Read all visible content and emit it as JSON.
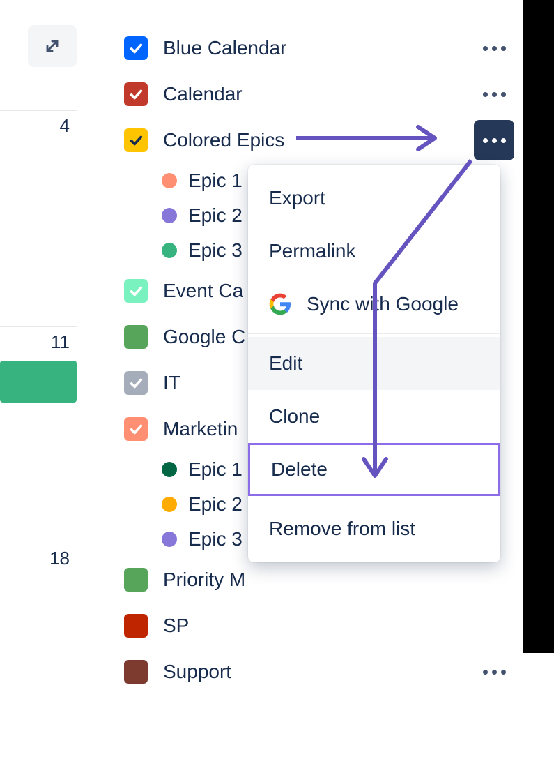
{
  "toolbar": {
    "expand_icon": "expand"
  },
  "days": [
    "4",
    "11",
    "18"
  ],
  "calendars": [
    {
      "label": "Blue Calendar",
      "color": "#0065ff",
      "check": "white",
      "has_menu": true
    },
    {
      "label": "Calendar",
      "color": "#c0392b",
      "check": "white",
      "has_menu": true
    },
    {
      "label": "Colored Epics",
      "color": "#ffc400",
      "check": "black",
      "has_menu": true,
      "active": true,
      "epics": [
        {
          "label": "Epic 1",
          "color": "#ff8f73"
        },
        {
          "label": "Epic 2",
          "color": "#8777d9"
        },
        {
          "label": "Epic 3",
          "color": "#36b37e"
        }
      ]
    },
    {
      "label": "Event Ca",
      "color": "#79f2c0",
      "check": "white",
      "has_menu": false
    },
    {
      "label": "Google C",
      "color": "#57a55a",
      "check": "none",
      "square": true,
      "has_menu": false
    },
    {
      "label": "IT",
      "color": "#a5adba",
      "check": "white",
      "has_menu": false
    },
    {
      "label": "Marketin",
      "color": "#ff8f73",
      "check": "white",
      "has_menu": false,
      "epics": [
        {
          "label": "Epic 1",
          "color": "#006644"
        },
        {
          "label": "Epic 2",
          "color": "#ffab00"
        },
        {
          "label": "Epic 3",
          "color": "#8777d9"
        }
      ]
    },
    {
      "label": "Priority M",
      "color": "#57a55a",
      "check": "none",
      "square": true,
      "has_menu": false
    },
    {
      "label": "SP",
      "color": "#bf2600",
      "check": "none",
      "square": true,
      "has_menu": false
    },
    {
      "label": "Support",
      "color": "#7c3b2e",
      "check": "none",
      "square": true,
      "has_menu": true
    }
  ],
  "menu": {
    "export": "Export",
    "permalink": "Permalink",
    "sync_google": "Sync with Google",
    "edit": "Edit",
    "clone": "Clone",
    "delete": "Delete",
    "remove": "Remove from list"
  }
}
